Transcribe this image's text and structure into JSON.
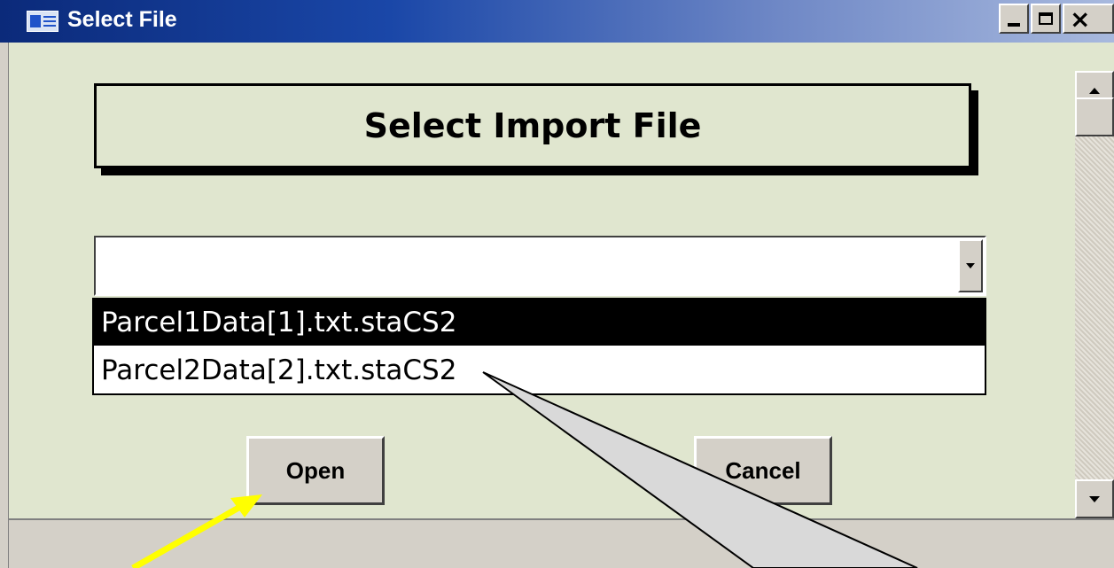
{
  "window": {
    "title": "Select File",
    "icon": "form-icon",
    "controls": {
      "minimize": "minimize-icon",
      "maximize": "maximize-icon",
      "close": "×"
    }
  },
  "form": {
    "heading": "Select Import File",
    "combo": {
      "value": "",
      "arrow_icon": "chevron-down-icon",
      "options": [
        "Parcel1Data[1].txt.staCS2",
        "Parcel2Data[2].txt.staCS2"
      ],
      "selected_index": 0
    },
    "buttons": {
      "open": "Open",
      "cancel": "Cancel"
    }
  },
  "colors": {
    "form_background": "#e0e6cf",
    "title_bar_start": "#0b2a7a",
    "title_bar_end": "#a8b9de",
    "selected_option": "#000000",
    "annotation_arrow": "#ffff00",
    "callout_fill": "#d9d9d9"
  },
  "annotations": {
    "arrow_target": "open-button",
    "callout_target": "dropdown-option-2"
  }
}
